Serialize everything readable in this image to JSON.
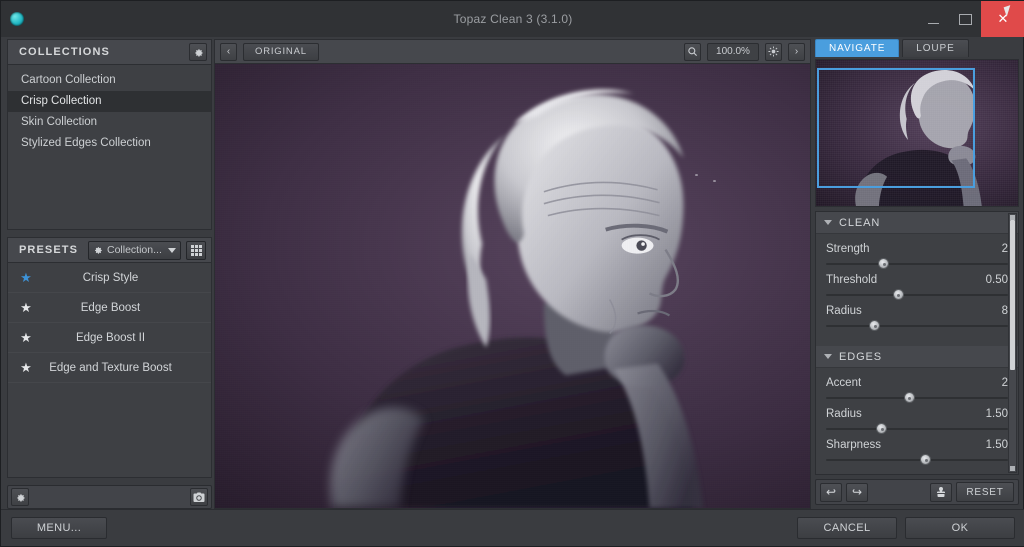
{
  "window": {
    "title": "Topaz Clean 3 (3.1.0)",
    "app_icon": "globe-icon",
    "minimize": "minimize-icon",
    "maximize": "maximize-icon",
    "close": "✕",
    "close_color": "#e04a4a"
  },
  "collections": {
    "header": "COLLECTIONS",
    "settings_icon": "gear-icon",
    "items": [
      {
        "label": "Cartoon Collection",
        "selected": false
      },
      {
        "label": "Crisp Collection",
        "selected": true
      },
      {
        "label": "Skin Collection",
        "selected": false
      },
      {
        "label": "Stylized Edges Collection",
        "selected": false
      }
    ]
  },
  "presets": {
    "header": "PRESETS",
    "filter_label": "Collection...",
    "filter_icon": "gear-icon",
    "view_toggle_icon": "grid-view-icon",
    "items": [
      {
        "name": "Crisp Style",
        "starred": true
      },
      {
        "name": "Edge Boost",
        "starred": false
      },
      {
        "name": "Edge Boost II",
        "starred": false
      },
      {
        "name": "Edge and Texture Boost",
        "starred": false
      }
    ],
    "star_glyph": "★",
    "star_active_color": "#3d93d8"
  },
  "left_footer": {
    "settings_icon": "gear-icon",
    "snapshot_icon": "camera-icon"
  },
  "viewer": {
    "prev_icon": "‹",
    "next_icon": "›",
    "original_label": "ORIGINAL",
    "search_icon": "magnifier-icon",
    "zoom_level": "100.0%",
    "brightness_icon": "brightness-icon"
  },
  "navigator": {
    "tabs": [
      {
        "label": "NAVIGATE",
        "active": true
      },
      {
        "label": "LOUPE",
        "active": false
      }
    ],
    "selection_color": "#4a9ede"
  },
  "parameters": {
    "sections": [
      {
        "title": "CLEAN",
        "collapse_icon": "triangle-down-icon",
        "rows": [
          {
            "name": "Strength",
            "value": "2",
            "pos": 32
          },
          {
            "name": "Threshold",
            "value": "0.50",
            "pos": 40
          },
          {
            "name": "Radius",
            "value": "8",
            "pos": 27
          }
        ]
      },
      {
        "title": "EDGES",
        "collapse_icon": "triangle-down-icon",
        "rows": [
          {
            "name": "Accent",
            "value": "2",
            "pos": 46
          },
          {
            "name": "Radius",
            "value": "1.50",
            "pos": 31
          },
          {
            "name": "Sharpness",
            "value": "1.50",
            "pos": 55
          }
        ]
      }
    ]
  },
  "right_footer": {
    "undo_icon": "↩",
    "redo_icon": "↪",
    "preview_icon": "stamp-icon",
    "reset_label": "RESET"
  },
  "bottom": {
    "menu_label": "MENU...",
    "cancel_label": "CANCEL",
    "ok_label": "OK"
  }
}
